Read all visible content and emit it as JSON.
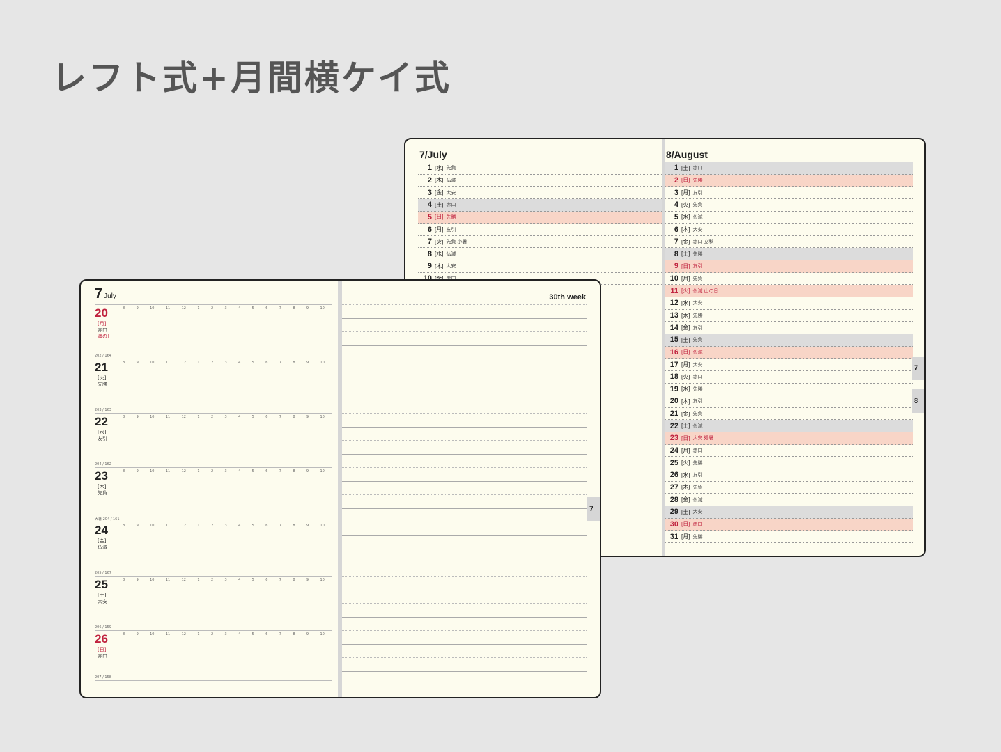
{
  "title": "レフト式+月間横ケイ式",
  "monthly": {
    "july": {
      "heading": "7/July",
      "rows": [
        {
          "d": "1",
          "w": "[水]",
          "r": "先負",
          "t": ""
        },
        {
          "d": "2",
          "w": "[木]",
          "r": "仏滅",
          "t": ""
        },
        {
          "d": "3",
          "w": "[金]",
          "r": "大安",
          "t": ""
        },
        {
          "d": "4",
          "w": "[土]",
          "r": "赤口",
          "t": "sat"
        },
        {
          "d": "5",
          "w": "[日]",
          "r": "先勝",
          "t": "sun"
        },
        {
          "d": "6",
          "w": "[月]",
          "r": "友引",
          "t": ""
        },
        {
          "d": "7",
          "w": "[火]",
          "r": "先負 小暑",
          "t": ""
        },
        {
          "d": "8",
          "w": "[水]",
          "r": "仏滅",
          "t": ""
        },
        {
          "d": "9",
          "w": "[木]",
          "r": "大安",
          "t": ""
        },
        {
          "d": "10",
          "w": "[金]",
          "r": "赤口",
          "t": ""
        }
      ]
    },
    "august": {
      "heading": "8/August",
      "rows": [
        {
          "d": "1",
          "w": "[土]",
          "r": "赤口",
          "t": "sat"
        },
        {
          "d": "2",
          "w": "[日]",
          "r": "先勝",
          "t": "sun"
        },
        {
          "d": "3",
          "w": "[月]",
          "r": "友引",
          "t": ""
        },
        {
          "d": "4",
          "w": "[火]",
          "r": "先負",
          "t": ""
        },
        {
          "d": "5",
          "w": "[水]",
          "r": "仏滅",
          "t": ""
        },
        {
          "d": "6",
          "w": "[木]",
          "r": "大安",
          "t": ""
        },
        {
          "d": "7",
          "w": "[金]",
          "r": "赤口 立秋",
          "t": ""
        },
        {
          "d": "8",
          "w": "[土]",
          "r": "先勝",
          "t": "sat"
        },
        {
          "d": "9",
          "w": "[日]",
          "r": "友引",
          "t": "sun"
        },
        {
          "d": "10",
          "w": "[月]",
          "r": "先負",
          "t": ""
        },
        {
          "d": "11",
          "w": "[火]",
          "r": "仏滅 山の日",
          "t": "sun"
        },
        {
          "d": "12",
          "w": "[水]",
          "r": "大安",
          "t": ""
        },
        {
          "d": "13",
          "w": "[木]",
          "r": "先勝",
          "t": ""
        },
        {
          "d": "14",
          "w": "[金]",
          "r": "友引",
          "t": ""
        },
        {
          "d": "15",
          "w": "[土]",
          "r": "先負",
          "t": "sat"
        },
        {
          "d": "16",
          "w": "[日]",
          "r": "仏滅",
          "t": "sun"
        },
        {
          "d": "17",
          "w": "[月]",
          "r": "大安",
          "t": ""
        },
        {
          "d": "18",
          "w": "[火]",
          "r": "赤口",
          "t": ""
        },
        {
          "d": "19",
          "w": "[水]",
          "r": "先勝",
          "t": ""
        },
        {
          "d": "20",
          "w": "[木]",
          "r": "友引",
          "t": ""
        },
        {
          "d": "21",
          "w": "[金]",
          "r": "先負",
          "t": ""
        },
        {
          "d": "22",
          "w": "[土]",
          "r": "仏滅",
          "t": "sat"
        },
        {
          "d": "23",
          "w": "[日]",
          "r": "大安 処暑",
          "t": "sun"
        },
        {
          "d": "24",
          "w": "[月]",
          "r": "赤口",
          "t": ""
        },
        {
          "d": "25",
          "w": "[火]",
          "r": "先勝",
          "t": ""
        },
        {
          "d": "26",
          "w": "[水]",
          "r": "友引",
          "t": ""
        },
        {
          "d": "27",
          "w": "[木]",
          "r": "先負",
          "t": ""
        },
        {
          "d": "28",
          "w": "[金]",
          "r": "仏滅",
          "t": ""
        },
        {
          "d": "29",
          "w": "[土]",
          "r": "大安",
          "t": "sat"
        },
        {
          "d": "30",
          "w": "[日]",
          "r": "赤口",
          "t": "sun"
        },
        {
          "d": "31",
          "w": "[月]",
          "r": "先勝",
          "t": ""
        }
      ]
    },
    "tabs": [
      "7",
      "8"
    ]
  },
  "weekly": {
    "month_num": "7",
    "month_name": "July",
    "week_label": "30th week",
    "tab": "7",
    "hours": [
      "8",
      "9",
      "10",
      "11",
      "12",
      "1",
      "2",
      "3",
      "4",
      "5",
      "6",
      "7",
      "8",
      "9",
      "10"
    ],
    "days": [
      {
        "d": "20",
        "w": "[月]",
        "r": "赤口",
        "h": "海の日",
        "meta": "",
        "red": true
      },
      {
        "d": "21",
        "w": "[火]",
        "r": "先勝",
        "h": "",
        "meta": "202 / 164",
        "red": false
      },
      {
        "d": "22",
        "w": "[水]",
        "r": "友引",
        "h": "",
        "meta": "203 / 163",
        "red": false
      },
      {
        "d": "23",
        "w": "[木]",
        "r": "先負",
        "h": "",
        "meta": "204 / 162",
        "red": false
      },
      {
        "d": "24",
        "w": "[金]",
        "r": "仏滅",
        "h": "",
        "meta": "大暑 204 / 161",
        "red": false
      },
      {
        "d": "25",
        "w": "[土]",
        "r": "大安",
        "h": "",
        "meta": "205 / 167",
        "red": false
      },
      {
        "d": "26",
        "w": "[日]",
        "r": "赤口",
        "h": "",
        "meta": "206 / 159",
        "red": true
      }
    ],
    "footer_meta": "207 / 158"
  },
  "colors": {
    "sat": "#dcdcdc",
    "sun": "#f8d5c7",
    "red": "#c0233f"
  }
}
